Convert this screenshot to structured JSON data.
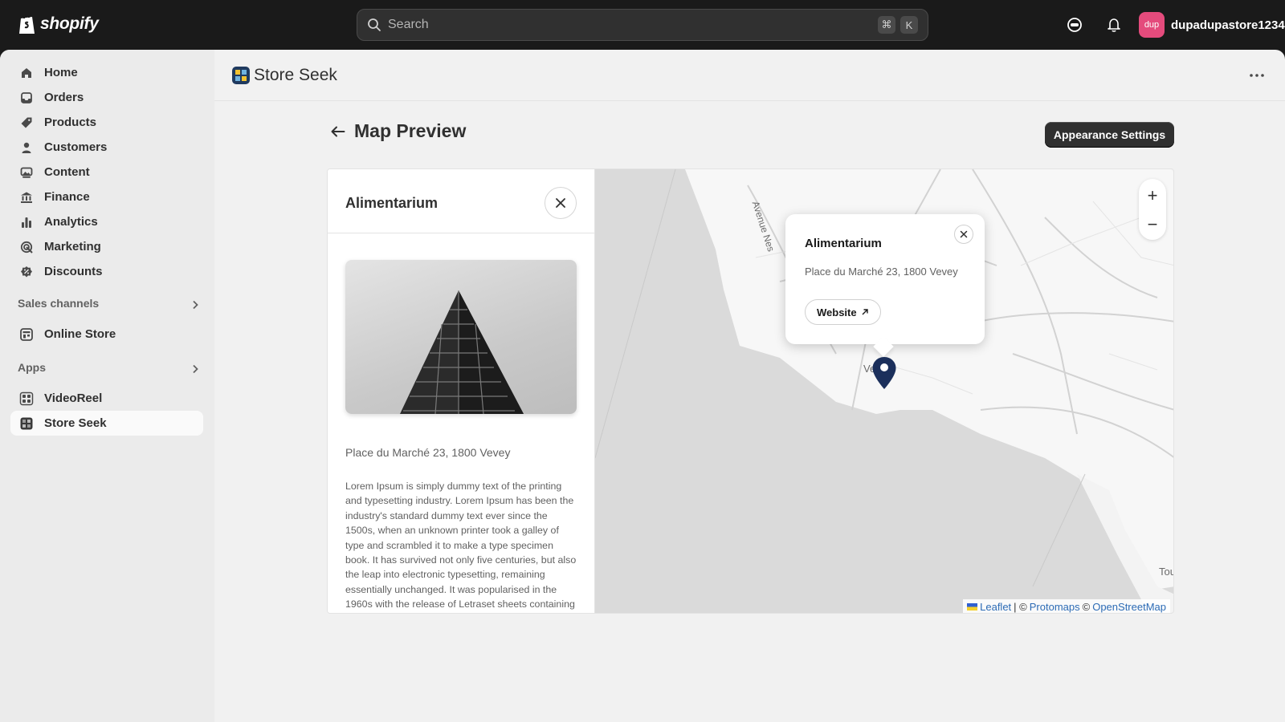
{
  "brand": {
    "logo_text": "shopify"
  },
  "search": {
    "placeholder": "Search",
    "shortcut_mod": "⌘",
    "shortcut_key": "K"
  },
  "user": {
    "initials": "dup",
    "name": "dupadupastore1234",
    "avatar_color": "#e44b7c"
  },
  "sidebar": {
    "items": [
      {
        "label": "Home",
        "icon": "home-icon"
      },
      {
        "label": "Orders",
        "icon": "inbox-icon"
      },
      {
        "label": "Products",
        "icon": "tag-icon"
      },
      {
        "label": "Customers",
        "icon": "person-icon"
      },
      {
        "label": "Content",
        "icon": "image-icon"
      },
      {
        "label": "Finance",
        "icon": "bank-icon"
      },
      {
        "label": "Analytics",
        "icon": "bar-chart-icon"
      },
      {
        "label": "Marketing",
        "icon": "target-icon"
      },
      {
        "label": "Discounts",
        "icon": "discount-icon"
      }
    ],
    "sales_channels": {
      "label": "Sales channels",
      "items": [
        {
          "label": "Online Store",
          "icon": "store-icon"
        }
      ]
    },
    "apps": {
      "label": "Apps",
      "items": [
        {
          "label": "VideoReel",
          "icon": "grid-icon"
        },
        {
          "label": "Store Seek",
          "icon": "store-seek-icon",
          "active": true
        }
      ]
    }
  },
  "app_header": {
    "title": "Store Seek"
  },
  "page": {
    "title": "Map Preview",
    "appearance_button": "Appearance Settings"
  },
  "location": {
    "name": "Alimentarium",
    "address": "Place du Marché 23, 1800 Vevey",
    "description": "Lorem Ipsum is simply dummy text of the printing and typesetting industry. Lorem Ipsum has been the industry's standard dummy text ever since the 1500s, when an unknown printer took a galley of type and scrambled it to make a type specimen book. It has survived not only five centuries, but also the leap into electronic typesetting, remaining essentially unchanged. It was popularised in the 1960s with the release of Letraset sheets containing Lorem Ipsum passages."
  },
  "popup": {
    "title": "Alimentarium",
    "address": "Place du Marché 23, 1800 Vevey",
    "website_label": "Website"
  },
  "map": {
    "zoom_in": "+",
    "zoom_out": "−",
    "labels": {
      "street": "Avenue Nes",
      "town": "Ve",
      "edge": "Tou"
    },
    "attribution": {
      "leaflet": "Leaflet",
      "sep1": "| ©",
      "protomaps": "Protomaps",
      "sep2": "©",
      "osm": "OpenStreetMap"
    },
    "pin_color": "#1b2f5b"
  }
}
